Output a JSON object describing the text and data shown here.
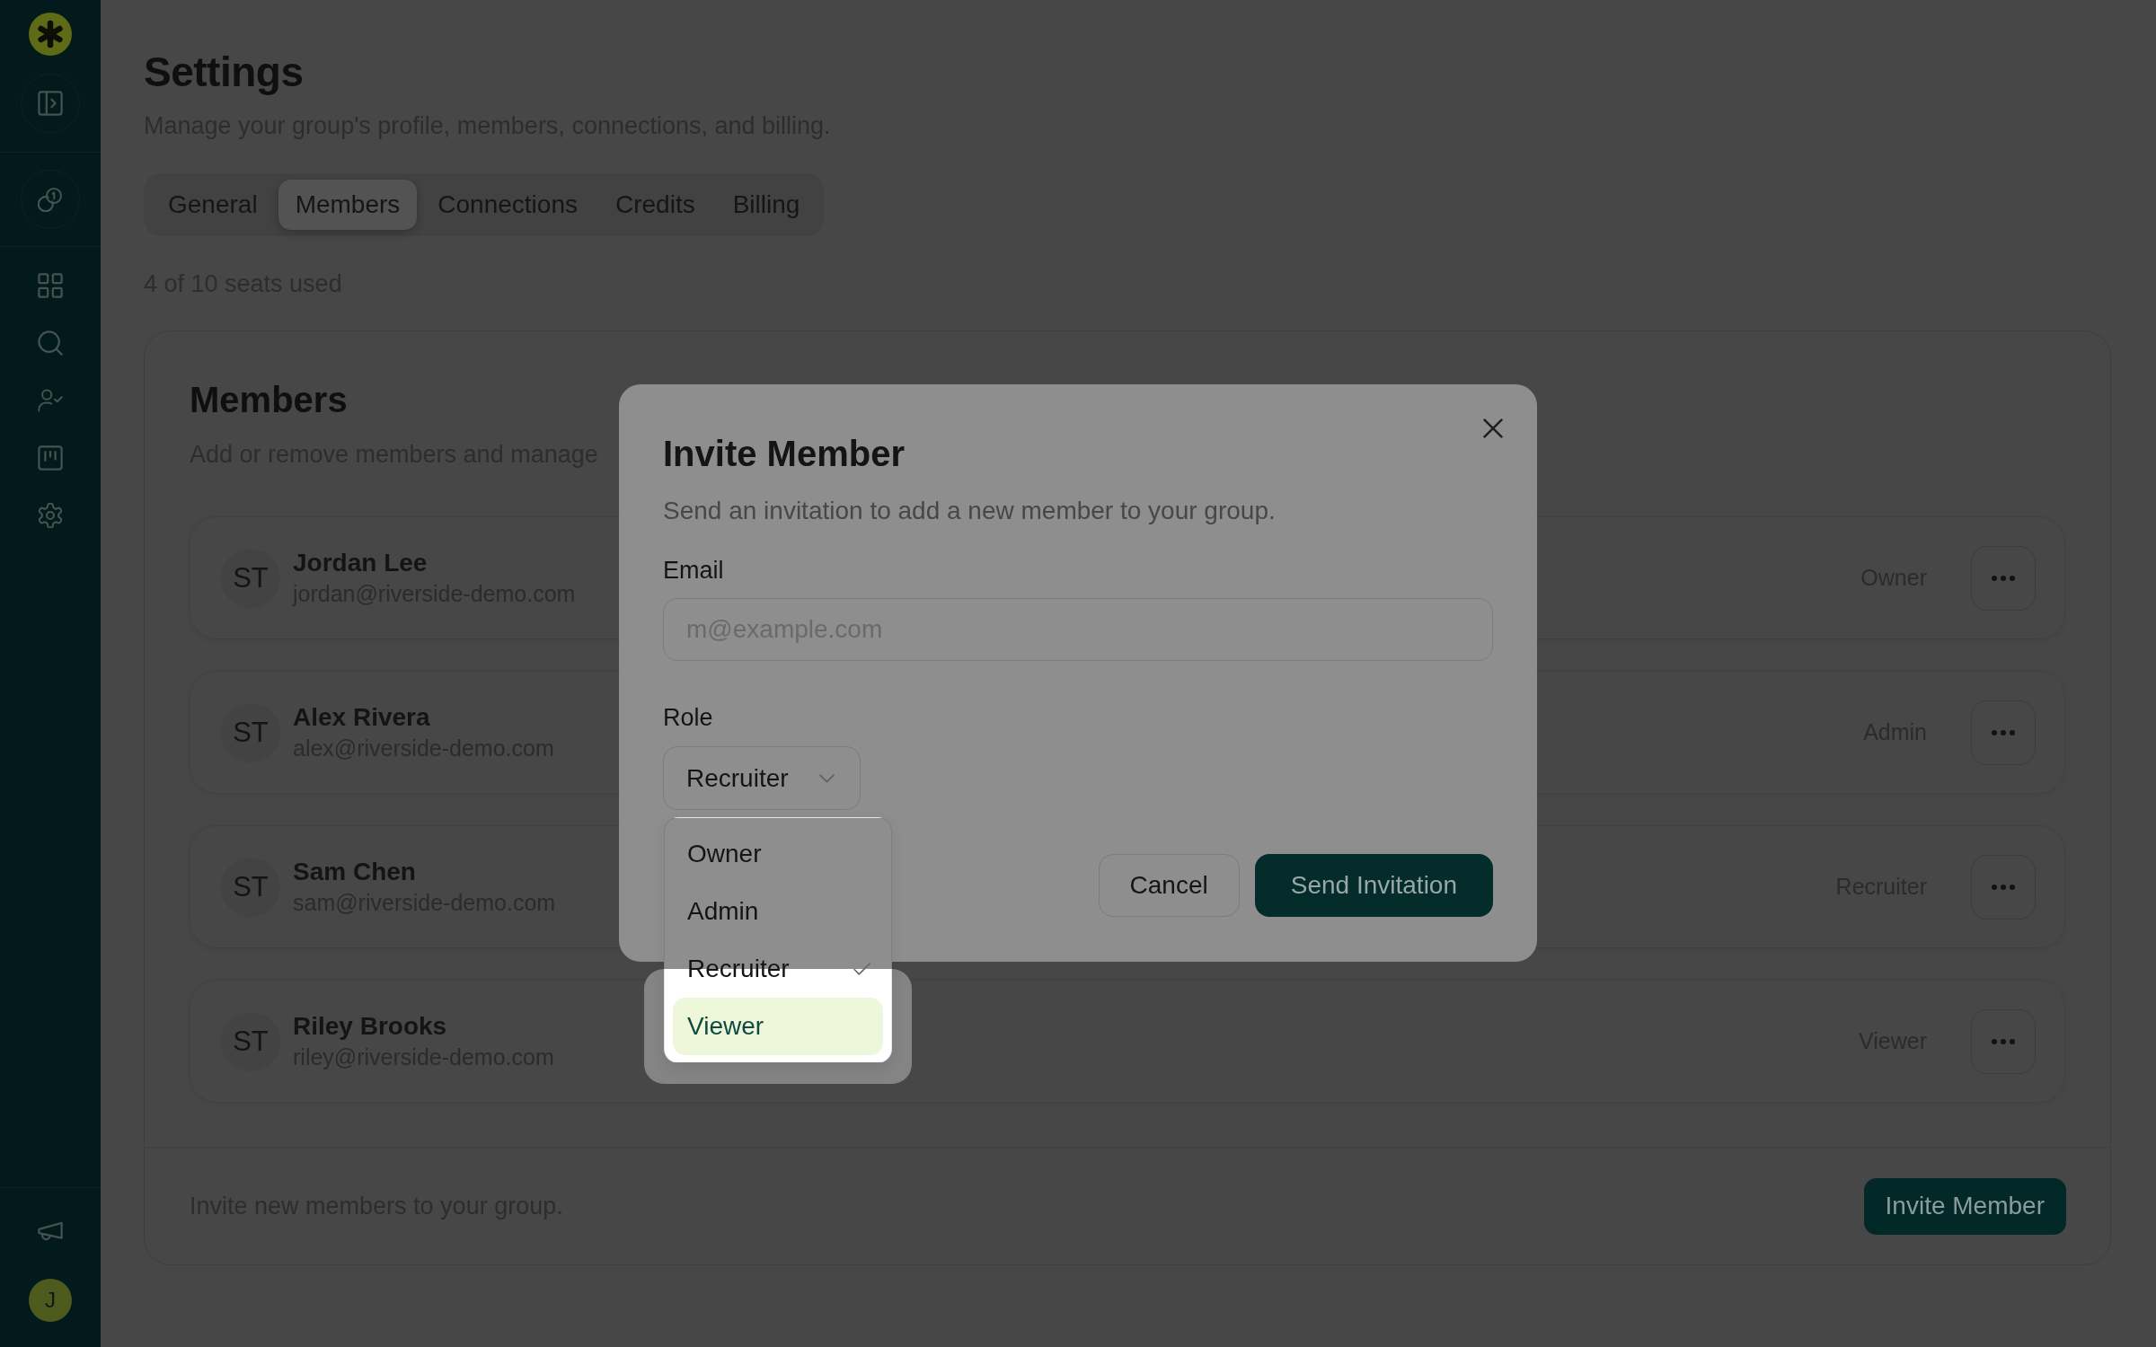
{
  "sidebar": {
    "avatar": "J"
  },
  "page": {
    "title": "Settings",
    "subtitle": "Manage your group's profile, members, connections, and billing."
  },
  "tabs": [
    {
      "label": "General",
      "selected": false
    },
    {
      "label": "Members",
      "selected": true
    },
    {
      "label": "Connections",
      "selected": false
    },
    {
      "label": "Credits",
      "selected": false
    },
    {
      "label": "Billing",
      "selected": false
    }
  ],
  "seats": "4 of 10 seats used",
  "members_card": {
    "title": "Members",
    "subtitle": "Add or remove members and manage",
    "members": [
      {
        "initials": "ST",
        "name": "Jordan Lee",
        "email": "jordan@riverside-demo.com",
        "role": "Owner"
      },
      {
        "initials": "ST",
        "name": "Alex Rivera",
        "email": "alex@riverside-demo.com",
        "role": "Admin"
      },
      {
        "initials": "ST",
        "name": "Sam Chen",
        "email": "sam@riverside-demo.com",
        "role": "Recruiter"
      },
      {
        "initials": "ST",
        "name": "Riley Brooks",
        "email": "riley@riverside-demo.com",
        "role": "Viewer"
      }
    ],
    "footer_text": "Invite new members to your group.",
    "invite_button": "Invite Member"
  },
  "dialog": {
    "title": "Invite Member",
    "description": "Send an invitation to add a new member to your group.",
    "email": {
      "label": "Email",
      "placeholder": "m@example.com"
    },
    "role": {
      "label": "Role",
      "value": "Recruiter",
      "options": [
        {
          "label": "Owner",
          "selected": false,
          "highlighted": false
        },
        {
          "label": "Admin",
          "selected": false,
          "highlighted": false
        },
        {
          "label": "Recruiter",
          "selected": true,
          "highlighted": false
        },
        {
          "label": "Viewer",
          "selected": false,
          "highlighted": true
        }
      ]
    },
    "buttons": [
      {
        "label": "Cancel",
        "kind": "secondary"
      },
      {
        "label": "Send Invitation",
        "kind": "primary"
      }
    ]
  }
}
